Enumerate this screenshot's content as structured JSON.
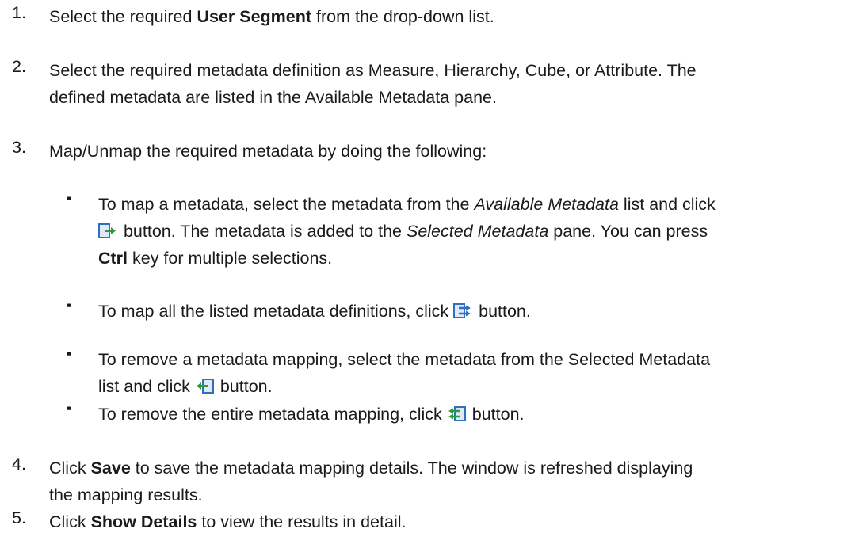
{
  "steps": [
    {
      "num": "1.",
      "pre": "Select the required ",
      "bold": "User Segment",
      "post": " from the drop-down list."
    },
    {
      "num": "2.",
      "line1": "Select the required metadata definition as Measure, Hierarchy, Cube, or Attribute. The",
      "line2": "defined metadata are listed in the Available Metadata pane."
    },
    {
      "num": "3.",
      "text": "Map/Unmap the required metadata by doing the following:"
    },
    {
      "num": "4.",
      "pre": "Click ",
      "bold": "Save",
      "post1": " to save the metadata mapping details. The window is refreshed displaying",
      "line2": "the mapping results."
    },
    {
      "num": "5.",
      "pre": "Click ",
      "bold": "Show Details",
      "post": " to view the results in detail."
    }
  ],
  "sub_items": [
    {
      "bullet": "▪",
      "pre": "To map a metadata, select the metadata from the ",
      "italic": "Available Metadata",
      "post": " list and click",
      "l2_post": " button. The metadata is added to the ",
      "l2_italic": "Selected Metadata",
      "l2_end": " pane. You can press",
      "l3_bold": "Ctrl",
      "l3_post": " key for multiple selections.",
      "icon": "map-selected-icon"
    },
    {
      "bullet": "▪",
      "pre": "To map all the listed metadata definitions, click ",
      "post": " button.",
      "icon": "map-all-icon"
    },
    {
      "bullet": "▪",
      "line1": "To remove a metadata mapping, select the metadata from the Selected Metadata",
      "pre": "list and click ",
      "post": " button.",
      "icon": "unmap-selected-icon"
    },
    {
      "bullet": "▪",
      "pre": "To remove the entire metadata mapping, click ",
      "post": " button.",
      "icon": "unmap-all-icon"
    }
  ],
  "colors": {
    "text": "#1a1a1a",
    "icon_blue": "#2f6fc0",
    "icon_green": "#2e9a3a"
  }
}
